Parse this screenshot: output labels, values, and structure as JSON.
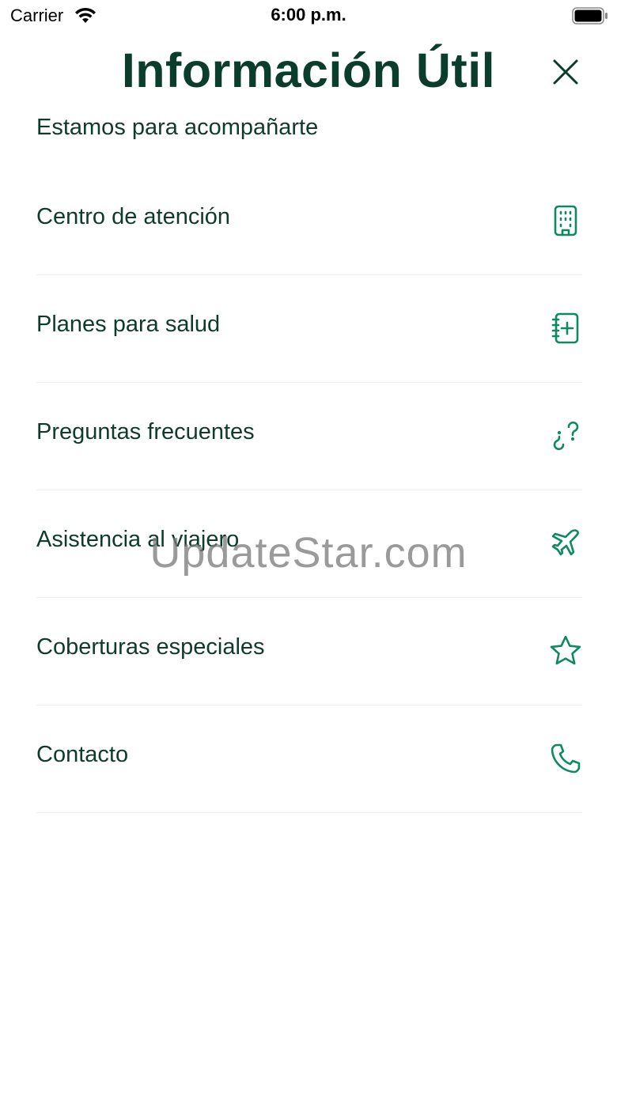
{
  "status_bar": {
    "carrier": "Carrier",
    "time": "6:00 p.m."
  },
  "header": {
    "title": "Información Útil",
    "close_icon": "close-icon"
  },
  "subtitle": "Estamos para acompañarte",
  "menu": {
    "items": [
      {
        "label": "Centro de atención",
        "icon": "building-icon"
      },
      {
        "label": "Planes para salud",
        "icon": "medical-notebook-icon"
      },
      {
        "label": "Preguntas frecuentes",
        "icon": "question-icon"
      },
      {
        "label": "Asistencia al viajero",
        "icon": "airplane-icon"
      },
      {
        "label": "Coberturas especiales",
        "icon": "star-icon"
      },
      {
        "label": "Contacto",
        "icon": "phone-icon"
      }
    ]
  },
  "watermark": "UpdateStar.com",
  "colors": {
    "title": "#0b3d2c",
    "text": "#0e3b2c",
    "icon_accent": "#0f8a5f",
    "divider": "#eeeeee"
  }
}
